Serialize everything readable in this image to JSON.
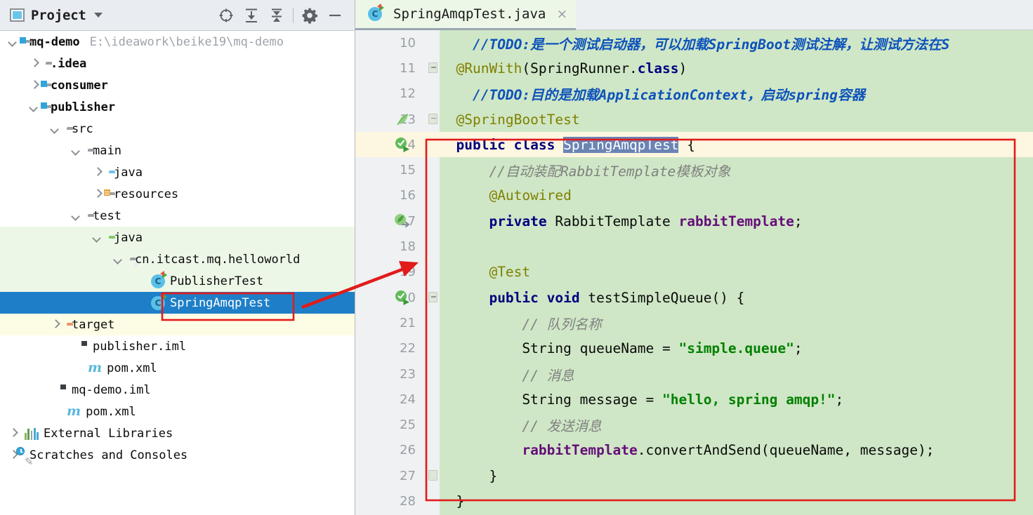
{
  "window": {
    "panel_title": "Project"
  },
  "toolbar": {
    "locate_label": "locate-file",
    "expand_label": "expand-all",
    "collapse_label": "collapse-all",
    "settings_label": "settings",
    "hide_label": "hide"
  },
  "tree": {
    "items": [
      {
        "label": "mq-demo",
        "path": "E:\\ideawork\\beike19\\mq-demo",
        "icon": "module-folder-icon",
        "arrow": "down",
        "indent": 0,
        "bold": true,
        "state": "normal"
      },
      {
        "label": ".idea",
        "path": "",
        "icon": "folder-icon",
        "arrow": "right",
        "indent": 1,
        "bold": true,
        "state": "normal"
      },
      {
        "label": "consumer",
        "path": "",
        "icon": "module-folder-icon",
        "arrow": "right",
        "indent": 1,
        "bold": true,
        "state": "normal"
      },
      {
        "label": "publisher",
        "path": "",
        "icon": "module-folder-icon",
        "arrow": "down",
        "indent": 1,
        "bold": true,
        "state": "normal"
      },
      {
        "label": "src",
        "path": "",
        "icon": "folder-icon",
        "arrow": "down",
        "indent": 2,
        "bold": false,
        "state": "normal"
      },
      {
        "label": "main",
        "path": "",
        "icon": "folder-icon",
        "arrow": "down",
        "indent": 3,
        "bold": false,
        "state": "normal"
      },
      {
        "label": "java",
        "path": "",
        "icon": "source-folder-icon",
        "arrow": "right",
        "indent": 4,
        "bold": false,
        "state": "normal"
      },
      {
        "label": "resources",
        "path": "",
        "icon": "resources-folder-icon",
        "arrow": "right",
        "indent": 4,
        "bold": false,
        "state": "normal"
      },
      {
        "label": "test",
        "path": "",
        "icon": "folder-icon",
        "arrow": "down",
        "indent": 3,
        "bold": false,
        "state": "normal"
      },
      {
        "label": "java",
        "path": "",
        "icon": "test-source-folder-icon",
        "arrow": "down",
        "indent": 4,
        "bold": false,
        "state": "testsrc"
      },
      {
        "label": "cn.itcast.mq.helloworld",
        "path": "",
        "icon": "package-icon",
        "arrow": "down",
        "indent": 5,
        "bold": false,
        "state": "testsrc"
      },
      {
        "label": "PublisherTest",
        "path": "",
        "icon": "java-class-icon",
        "arrow": "none",
        "indent": 6,
        "bold": false,
        "state": "testsrc"
      },
      {
        "label": "SpringAmqpTest",
        "path": "",
        "icon": "java-class-icon",
        "arrow": "none",
        "indent": 6,
        "bold": false,
        "state": "selected"
      },
      {
        "label": "target",
        "path": "",
        "icon": "excluded-folder-icon",
        "arrow": "right",
        "indent": 2,
        "bold": false,
        "state": "target"
      },
      {
        "label": "publisher.iml",
        "path": "",
        "icon": "iml-file-icon",
        "arrow": "none",
        "indent": 3,
        "bold": false,
        "state": "normal"
      },
      {
        "label": "pom.xml",
        "path": "",
        "icon": "maven-file-icon",
        "arrow": "none",
        "indent": 3,
        "bold": false,
        "state": "normal"
      },
      {
        "label": "mq-demo.iml",
        "path": "",
        "icon": "iml-file-icon",
        "arrow": "none",
        "indent": 2,
        "bold": false,
        "state": "normal"
      },
      {
        "label": "pom.xml",
        "path": "",
        "icon": "maven-file-icon",
        "arrow": "none",
        "indent": 2,
        "bold": false,
        "state": "normal"
      },
      {
        "label": "External Libraries",
        "path": "",
        "icon": "external-libraries-icon",
        "arrow": "right",
        "indent": 0,
        "bold": false,
        "state": "normal"
      },
      {
        "label": "Scratches and Consoles",
        "path": "",
        "icon": "scratches-icon",
        "arrow": "right",
        "indent": 0,
        "bold": false,
        "state": "normal"
      }
    ]
  },
  "editor": {
    "tab": {
      "label": "SpringAmqpTest.java",
      "icon": "java-class-icon",
      "close": "×"
    },
    "first_line_number": 10,
    "lines": [
      {
        "num": 10,
        "gutter_icon": "none",
        "fold": "none",
        "caret": false,
        "tokens": [
          {
            "t": "    ",
            "c": "plain"
          },
          {
            "t": "//TODO:是一个测试启动器，可以加载SpringBoot测试注解，让测试方法在S",
            "c": "todo"
          }
        ]
      },
      {
        "num": 11,
        "gutter_icon": "none",
        "fold": "top",
        "caret": false,
        "tokens": [
          {
            "t": "  ",
            "c": "plain"
          },
          {
            "t": "@RunWith",
            "c": "ann"
          },
          {
            "t": "(SpringRunner.",
            "c": "plain"
          },
          {
            "t": "class",
            "c": "kw"
          },
          {
            "t": ")",
            "c": "plain"
          }
        ]
      },
      {
        "num": 12,
        "gutter_icon": "none",
        "fold": "none",
        "caret": false,
        "tokens": [
          {
            "t": "    ",
            "c": "plain"
          },
          {
            "t": "//TODO:目的是加载ApplicationContext，启动spring容器",
            "c": "todo"
          }
        ]
      },
      {
        "num": 13,
        "gutter_icon": "spring-leaf-icon",
        "fold": "top",
        "caret": false,
        "tokens": [
          {
            "t": "  ",
            "c": "plain"
          },
          {
            "t": "@SpringBootTest",
            "c": "ann"
          }
        ]
      },
      {
        "num": 14,
        "gutter_icon": "run-test-icon",
        "fold": "none",
        "caret": true,
        "tokens": [
          {
            "t": "  ",
            "c": "plain"
          },
          {
            "t": "public class ",
            "c": "kw"
          },
          {
            "t": "SpringAmqpTest",
            "c": "sel-token"
          },
          {
            "t": " {",
            "c": "plain"
          }
        ]
      },
      {
        "num": 15,
        "gutter_icon": "none",
        "fold": "none",
        "caret": false,
        "tokens": [
          {
            "t": "      ",
            "c": "plain"
          },
          {
            "t": "//自动装配RabbitTemplate模板对象",
            "c": "cmt"
          }
        ]
      },
      {
        "num": 16,
        "gutter_icon": "none",
        "fold": "none",
        "caret": false,
        "tokens": [
          {
            "t": "      ",
            "c": "plain"
          },
          {
            "t": "@Autowired",
            "c": "ann"
          }
        ]
      },
      {
        "num": 17,
        "gutter_icon": "bean-nav-icon",
        "fold": "none",
        "caret": false,
        "tokens": [
          {
            "t": "      ",
            "c": "plain"
          },
          {
            "t": "private ",
            "c": "kw"
          },
          {
            "t": "RabbitTemplate ",
            "c": "plain"
          },
          {
            "t": "rabbitTemplate",
            "c": "fld"
          },
          {
            "t": ";",
            "c": "plain"
          }
        ]
      },
      {
        "num": 18,
        "gutter_icon": "none",
        "fold": "none",
        "caret": false,
        "tokens": []
      },
      {
        "num": 19,
        "gutter_icon": "none",
        "fold": "none",
        "caret": false,
        "tokens": [
          {
            "t": "      ",
            "c": "plain"
          },
          {
            "t": "@Test",
            "c": "ann"
          }
        ]
      },
      {
        "num": 20,
        "gutter_icon": "run-test-icon",
        "fold": "top",
        "caret": false,
        "tokens": [
          {
            "t": "      ",
            "c": "plain"
          },
          {
            "t": "public void ",
            "c": "kw"
          },
          {
            "t": "testSimpleQueue() {",
            "c": "plain"
          }
        ]
      },
      {
        "num": 21,
        "gutter_icon": "none",
        "fold": "none",
        "caret": false,
        "tokens": [
          {
            "t": "          ",
            "c": "plain"
          },
          {
            "t": "// 队列名称",
            "c": "cmt"
          }
        ]
      },
      {
        "num": 22,
        "gutter_icon": "none",
        "fold": "none",
        "caret": false,
        "tokens": [
          {
            "t": "          ",
            "c": "plain"
          },
          {
            "t": "String queueName = ",
            "c": "plain"
          },
          {
            "t": "\"simple.queue\"",
            "c": "str"
          },
          {
            "t": ";",
            "c": "plain"
          }
        ]
      },
      {
        "num": 23,
        "gutter_icon": "none",
        "fold": "none",
        "caret": false,
        "tokens": [
          {
            "t": "          ",
            "c": "plain"
          },
          {
            "t": "// 消息",
            "c": "cmt"
          }
        ]
      },
      {
        "num": 24,
        "gutter_icon": "none",
        "fold": "none",
        "caret": false,
        "tokens": [
          {
            "t": "          ",
            "c": "plain"
          },
          {
            "t": "String message = ",
            "c": "plain"
          },
          {
            "t": "\"hello, spring amqp!\"",
            "c": "str"
          },
          {
            "t": ";",
            "c": "plain"
          }
        ]
      },
      {
        "num": 25,
        "gutter_icon": "none",
        "fold": "none",
        "caret": false,
        "tokens": [
          {
            "t": "          ",
            "c": "plain"
          },
          {
            "t": "// 发送消息",
            "c": "cmt"
          }
        ]
      },
      {
        "num": 26,
        "gutter_icon": "none",
        "fold": "none",
        "caret": false,
        "tokens": [
          {
            "t": "          ",
            "c": "plain"
          },
          {
            "t": "rabbitTemplate",
            "c": "fld"
          },
          {
            "t": ".convertAndSend(queueName, message);",
            "c": "plain"
          }
        ]
      },
      {
        "num": 27,
        "gutter_icon": "none",
        "fold": "bot",
        "caret": false,
        "tokens": [
          {
            "t": "      ",
            "c": "plain"
          },
          {
            "t": "}",
            "c": "plain"
          }
        ]
      },
      {
        "num": 28,
        "gutter_icon": "none",
        "fold": "none",
        "caret": false,
        "tokens": [
          {
            "t": "  ",
            "c": "plain"
          },
          {
            "t": "}",
            "c": "plain"
          }
        ]
      }
    ]
  },
  "annotations": {
    "tree_highlight_label": "selected-file-callout",
    "class_highlight_label": "class-body-callout",
    "arrow_label": "pointer-arrow",
    "color": "#e21b1b"
  },
  "colors": {
    "selection_blue": "#1e7fc8",
    "test_source_green": "#edf7e8",
    "excluded_yellow": "#fdfde6",
    "editor_modified_green": "#cfe7c6",
    "caret_line": "#fdf6e0",
    "token_selection": "#6a84b4",
    "annotation_red": "#e21b1b"
  }
}
